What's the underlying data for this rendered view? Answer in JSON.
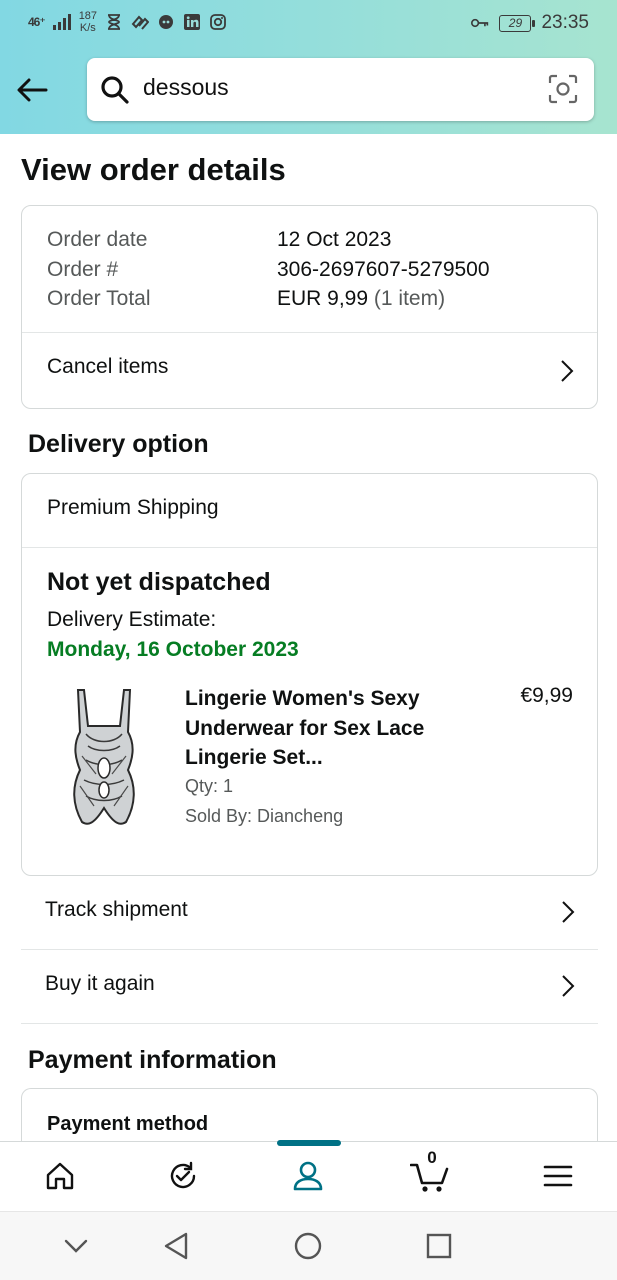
{
  "status_bar": {
    "network": "46⁺",
    "speed_value": "187",
    "speed_unit": "K/s",
    "battery": "29",
    "time": "23:35"
  },
  "search": {
    "value": "dessous"
  },
  "page": {
    "title": "View order details"
  },
  "order_summary": {
    "date_label": "Order date",
    "date_value": "12 Oct 2023",
    "number_label": "Order #",
    "number_value": "306-2697607-5279500",
    "total_label": "Order Total",
    "total_value": "EUR 9,99",
    "total_items": "(1 item)",
    "cancel_label": "Cancel items"
  },
  "delivery": {
    "section_title": "Delivery option",
    "shipping_method": "Premium Shipping",
    "status": "Not yet dispatched",
    "estimate_label": "Delivery Estimate:",
    "estimate_date": "Monday, 16 October 2023",
    "product": {
      "title": "Lingerie Women's Sexy Underwear for Sex Lace Lingerie Set...",
      "price": "€9,99",
      "qty": "Qty: 1",
      "seller": "Sold By: Diancheng"
    }
  },
  "actions": {
    "track": "Track shipment",
    "buy_again": "Buy it again"
  },
  "payment": {
    "section_title": "Payment information",
    "method_label": "Payment method"
  },
  "bottom_nav": {
    "cart_count": "0"
  },
  "colors": {
    "accent": "#007185",
    "delivery_green": "#067d23",
    "header_gradient_start": "#82d8e3",
    "header_gradient_end": "#a7e4d0"
  }
}
